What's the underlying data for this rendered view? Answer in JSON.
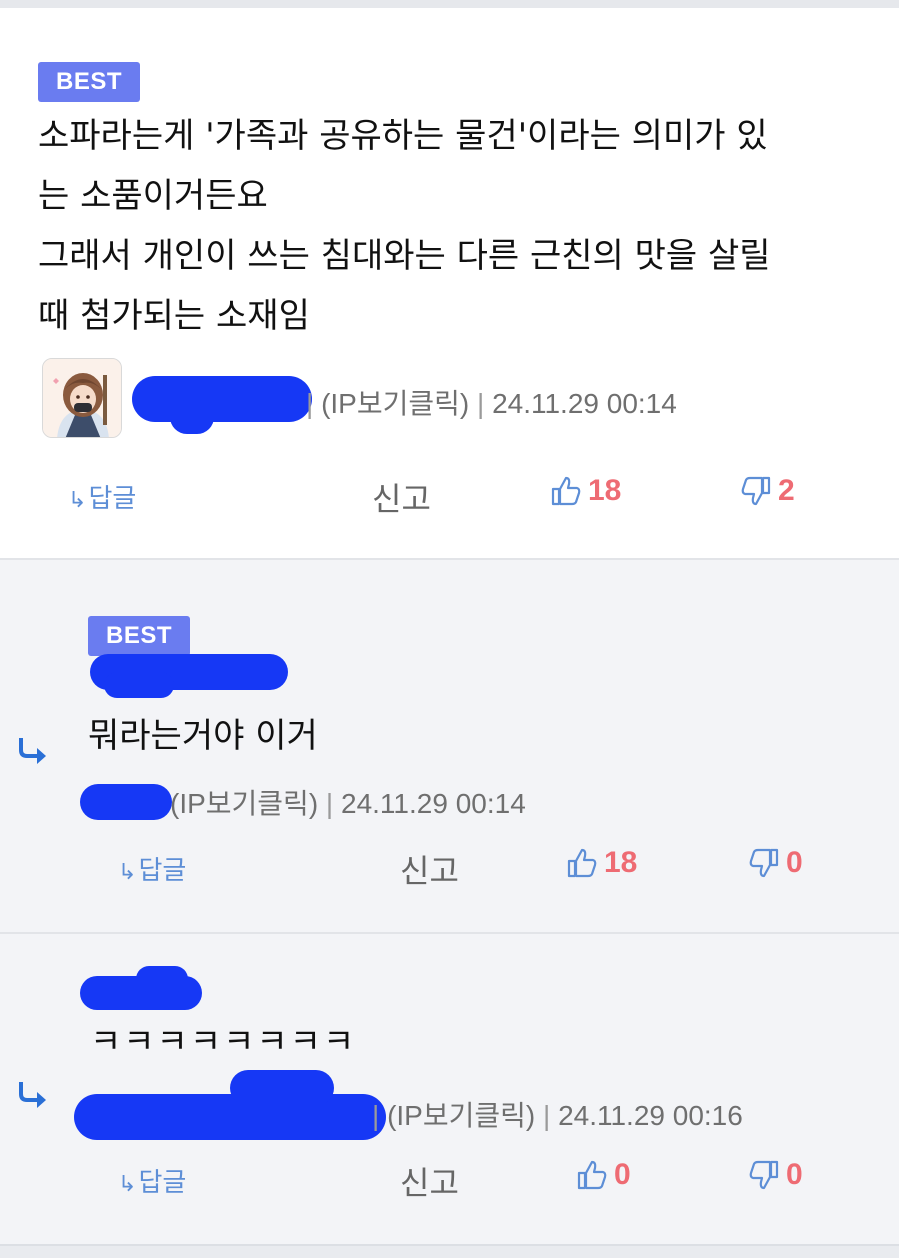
{
  "comments": [
    {
      "badge": "BEST",
      "text": "소파라는게 '가족과 공유하는 물건'이라는 의미가 있\n는 소품이거든요\n그래서 개인이 쓰는 침대와는 다른 근친의 맛을 살릴\n때 첨가되는 소재임",
      "meta_tail": "(IP보기클릭)",
      "datetime": "24.11.29 00:14",
      "reply_label": "답글",
      "report_label": "신고",
      "likes": "18",
      "dislikes": "2"
    },
    {
      "badge": "BEST",
      "text": "뭐라는거야 이거",
      "meta_tail": "(IP보기클릭)",
      "datetime": "24.11.29 00:14",
      "reply_label": "답글",
      "report_label": "신고",
      "likes": "18",
      "dislikes": "0"
    },
    {
      "text": "ㅋㅋㅋㅋㅋㅋㅋㅋ",
      "meta_tail": "(IP보기클릭)",
      "datetime": "24.11.29 00:16",
      "reply_label": "답글",
      "report_label": "신고",
      "likes": "0",
      "dislikes": "0"
    }
  ],
  "icons": {
    "thumb_up": "thumbs-up-icon",
    "thumb_down": "thumbs-down-icon",
    "reply_arrow": "reply-arrow-icon"
  },
  "colors": {
    "best_badge": "#6a7cf0",
    "vote": "#ee6b73",
    "link": "#5d8ed6",
    "redaction": "#1638f5"
  }
}
